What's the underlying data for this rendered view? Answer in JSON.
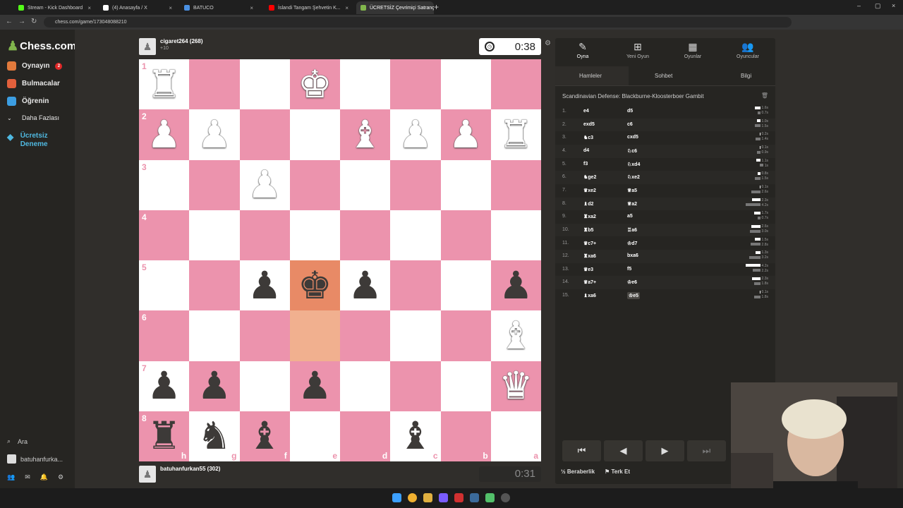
{
  "browser": {
    "tabs": [
      {
        "title": "Stream - Kick Dashboard",
        "color": "#53fc18"
      },
      {
        "title": "(4) Anasayfa / X",
        "color": "#ffffff"
      },
      {
        "title": "BATUCO",
        "color": "#4a90e2"
      },
      {
        "title": "İslandi Tangam Şehvetin K...",
        "color": "#ff0000"
      },
      {
        "title": "ÜCRETSİZ Çevrimiçi Satranç",
        "color": "#81b64c",
        "active": true
      }
    ],
    "url": "chess.com/game/173048088210"
  },
  "sidebar": {
    "logo": "Chess.com",
    "items": [
      {
        "label": "Oynayın",
        "badge": "2",
        "color": "#e27a3c"
      },
      {
        "label": "Bulmacalar",
        "color": "#e2603c"
      },
      {
        "label": "Öğrenin",
        "color": "#3c9ee2"
      },
      {
        "label": "Daha Fazlası"
      },
      {
        "label": "Ücretsiz Deneme",
        "color": "#4fb8e0"
      }
    ],
    "search_label": "Ara",
    "user_label": "batuhanfurka...",
    "notif_counts": [
      "37",
      "21",
      "2"
    ]
  },
  "top_player": {
    "name": "cigaret264 (268)",
    "sub": "+10",
    "clock": "0:38"
  },
  "bottom_player": {
    "name": "batuhanfurkan55 (302)",
    "clock": "0:31"
  },
  "board": {
    "ranks": [
      "1",
      "2",
      "3",
      "4",
      "5",
      "6",
      "7",
      "8"
    ],
    "files": [
      "h",
      "g",
      "f",
      "e",
      "d",
      "c",
      "b",
      "a"
    ],
    "pieces": [
      {
        "r": 0,
        "c": 0,
        "p": "♜",
        "side": "w"
      },
      {
        "r": 0,
        "c": 3,
        "p": "♚",
        "side": "w"
      },
      {
        "r": 1,
        "c": 0,
        "p": "♟",
        "side": "w"
      },
      {
        "r": 1,
        "c": 1,
        "p": "♟",
        "side": "w"
      },
      {
        "r": 1,
        "c": 4,
        "p": "♝",
        "side": "w"
      },
      {
        "r": 1,
        "c": 5,
        "p": "♟",
        "side": "w"
      },
      {
        "r": 1,
        "c": 6,
        "p": "♟",
        "side": "w"
      },
      {
        "r": 1,
        "c": 7,
        "p": "♜",
        "side": "w"
      },
      {
        "r": 2,
        "c": 2,
        "p": "♟",
        "side": "w"
      },
      {
        "r": 4,
        "c": 2,
        "p": "♟",
        "side": "b"
      },
      {
        "r": 4,
        "c": 3,
        "p": "♚",
        "side": "b"
      },
      {
        "r": 4,
        "c": 4,
        "p": "♟",
        "side": "b"
      },
      {
        "r": 4,
        "c": 7,
        "p": "♟",
        "side": "b"
      },
      {
        "r": 5,
        "c": 7,
        "p": "♝",
        "side": "w"
      },
      {
        "r": 6,
        "c": 0,
        "p": "♟",
        "side": "b"
      },
      {
        "r": 6,
        "c": 1,
        "p": "♟",
        "side": "b"
      },
      {
        "r": 6,
        "c": 3,
        "p": "♟",
        "side": "b"
      },
      {
        "r": 6,
        "c": 7,
        "p": "♛",
        "side": "w"
      },
      {
        "r": 7,
        "c": 0,
        "p": "♜",
        "side": "b"
      },
      {
        "r": 7,
        "c": 1,
        "p": "♞",
        "side": "b"
      },
      {
        "r": 7,
        "c": 2,
        "p": "♝",
        "side": "b"
      },
      {
        "r": 7,
        "c": 5,
        "p": "♝",
        "side": "b"
      }
    ],
    "highlights": [
      {
        "r": 4,
        "c": 3,
        "kind": "hl"
      },
      {
        "r": 5,
        "c": 3,
        "kind": "hl2"
      }
    ]
  },
  "panel": {
    "tabs": [
      {
        "label": "Oyna",
        "icon": "✎"
      },
      {
        "label": "Yeni Oyun",
        "icon": "⊞"
      },
      {
        "label": "Oyunlar",
        "icon": "▦"
      },
      {
        "label": "Oyuncular",
        "icon": "👥"
      }
    ],
    "subtabs": [
      "Hamleler",
      "Sohbet",
      "Bilgi"
    ],
    "opening": "Scandinavian Defense: Blackburne-Kloosterboer Gambit",
    "moves": [
      {
        "n": "1.",
        "w": "e4",
        "b": "d5",
        "tw": "1.6s",
        "tb": "0.7s"
      },
      {
        "n": "2.",
        "w": "exd5",
        "b": "c6",
        "tw": "1.0s",
        "tb": "1.5s"
      },
      {
        "n": "3.",
        "w": "♞c3",
        "b": "cxd5",
        "tw": "0.2s",
        "tb": "1.4s"
      },
      {
        "n": "4.",
        "w": "d4",
        "b": "♘c6",
        "tw": "0.1s",
        "tb": "0.9s"
      },
      {
        "n": "5.",
        "w": "f3",
        "b": "♘xd4",
        "tw": "1.1s",
        "tb": "1s"
      },
      {
        "n": "6.",
        "w": "♞ge2",
        "b": "♘xe2",
        "tw": "0.8s",
        "tb": "1.5s"
      },
      {
        "n": "7.",
        "w": "♛xe2",
        "b": "♕a5",
        "tw": "0.1s",
        "tb": "2.6s"
      },
      {
        "n": "8.",
        "w": "♝d2",
        "b": "♕a2",
        "tw": "2.3s",
        "tb": "4.2s"
      },
      {
        "n": "9.",
        "w": "♜xa2",
        "b": "a5",
        "tw": "1.7s",
        "tb": "0.7s"
      },
      {
        "n": "10.",
        "w": "♜b5",
        "b": "♖a6",
        "tw": "2.6s",
        "tb": "3.0s"
      },
      {
        "n": "11.",
        "w": "♛c7+",
        "b": "♔d7",
        "tw": "1.5s",
        "tb": "2.8s"
      },
      {
        "n": "12.",
        "w": "♜xa6",
        "b": "bxa6",
        "tw": "1.3s",
        "tb": "3.2s"
      },
      {
        "n": "13.",
        "w": "♛e3",
        "b": "f5",
        "tw": "4.2s",
        "tb": "2.2s"
      },
      {
        "n": "14.",
        "w": "♛a7+",
        "b": "♔e6",
        "tw": "2.3s",
        "tb": "1.8s"
      },
      {
        "n": "15.",
        "w": "♝xa6",
        "b": "♔e5",
        "tw": "0.1s",
        "tb": "1.8s"
      }
    ],
    "nav": [
      "⏮",
      "◀",
      "▶",
      "⏭"
    ],
    "draw_label": "Beraberlik",
    "resign_label": "Terk Et"
  }
}
